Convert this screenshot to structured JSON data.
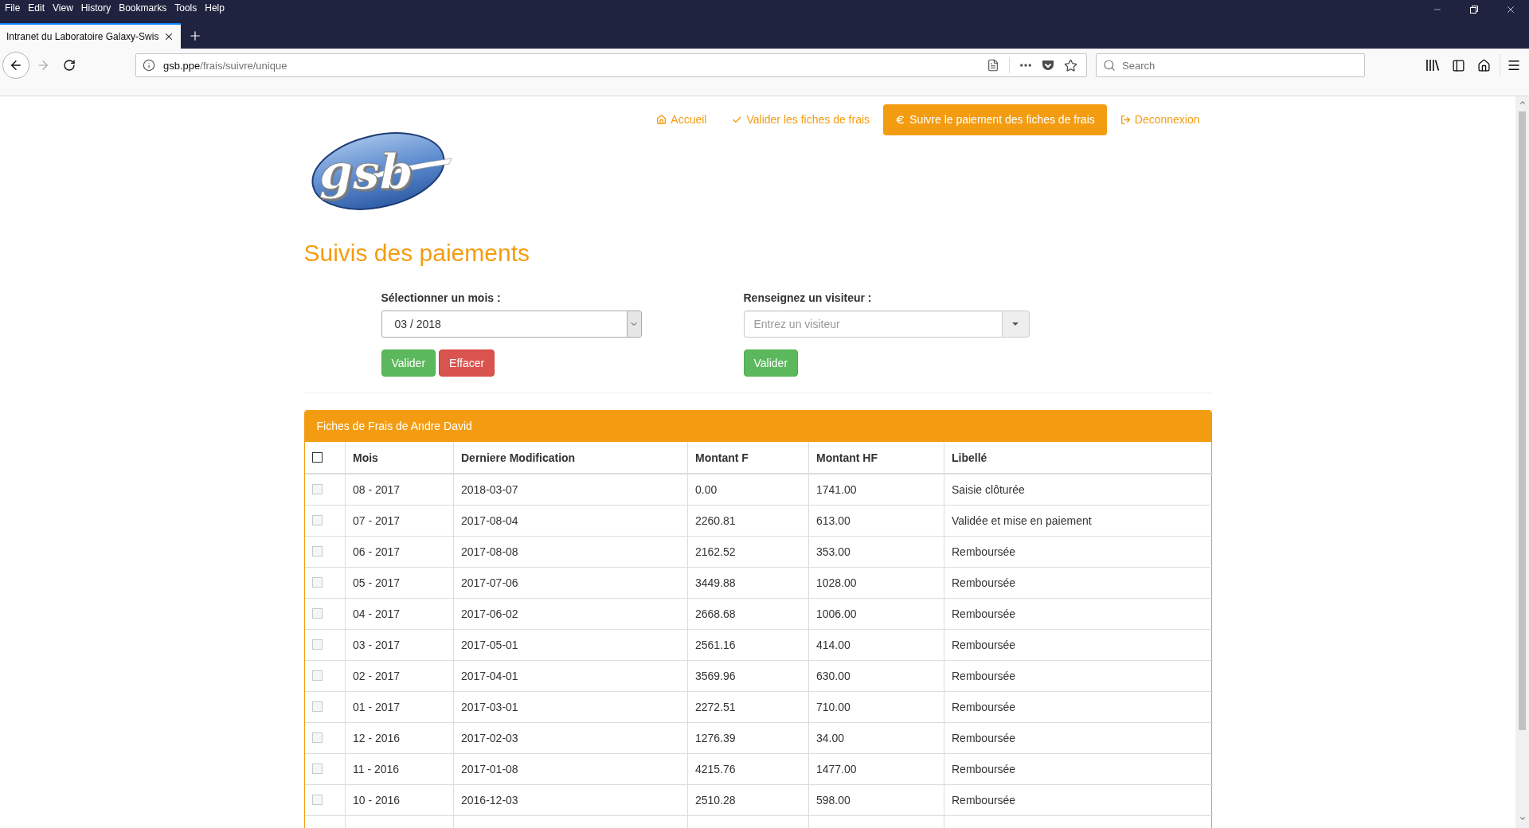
{
  "browser": {
    "menu": [
      "File",
      "Edit",
      "View",
      "History",
      "Bookmarks",
      "Tools",
      "Help"
    ],
    "tabs": [
      {
        "title": "Intranet du Laboratoire Galaxy-Swis",
        "selected": true
      }
    ],
    "url": {
      "host": "gsb.ppe",
      "path": "/frais/suivre/unique"
    },
    "search": {
      "placeholder": "Search"
    }
  },
  "page": {
    "logo": {
      "text": "gsb"
    },
    "nav": [
      {
        "label": "Accueil",
        "selected": false
      },
      {
        "label": "Valider les fiches de frais",
        "selected": false
      },
      {
        "label": "Suivre le paiement des fiches de frais",
        "selected": true
      },
      {
        "label": "Deconnexion",
        "selected": false
      }
    ],
    "title": "Suivis des paiements",
    "month": {
      "label": "Sélectionner un mois :",
      "value": "03 / 2018",
      "buttons": [
        {
          "label": "Valider",
          "kind": "success"
        },
        {
          "label": "Effacer",
          "kind": "danger"
        }
      ]
    },
    "visitor": {
      "label": "Renseignez un visiteur :",
      "placeholder": "Entrez un visiteur",
      "buttons": [
        {
          "label": "Valider",
          "kind": "success"
        }
      ]
    },
    "panel": {
      "title": "Fiches de Frais de Andre David",
      "select_all": {
        "checked": false,
        "disabled": false
      },
      "columns": [
        "Mois",
        "Derniere Modification",
        "Montant F",
        "Montant HF",
        "Libellé"
      ],
      "rows": [
        {
          "checked": false,
          "disabled": true,
          "cells": [
            "08 - 2017",
            "2018-03-07",
            "0.00",
            "1741.00",
            "Saisie clôturée"
          ]
        },
        {
          "checked": false,
          "disabled": true,
          "cells": [
            "07 - 2017",
            "2017-08-04",
            "2260.81",
            "613.00",
            "Validée et mise en paiement"
          ]
        },
        {
          "checked": false,
          "disabled": true,
          "cells": [
            "06 - 2017",
            "2017-08-08",
            "2162.52",
            "353.00",
            "Remboursée"
          ]
        },
        {
          "checked": false,
          "disabled": true,
          "cells": [
            "05 - 2017",
            "2017-07-06",
            "3449.88",
            "1028.00",
            "Remboursée"
          ]
        },
        {
          "checked": false,
          "disabled": true,
          "cells": [
            "04 - 2017",
            "2017-06-02",
            "2668.68",
            "1006.00",
            "Remboursée"
          ]
        },
        {
          "checked": false,
          "disabled": true,
          "cells": [
            "03 - 2017",
            "2017-05-01",
            "2561.16",
            "414.00",
            "Remboursée"
          ]
        },
        {
          "checked": false,
          "disabled": true,
          "cells": [
            "02 - 2017",
            "2017-04-01",
            "3569.96",
            "630.00",
            "Remboursée"
          ]
        },
        {
          "checked": false,
          "disabled": true,
          "cells": [
            "01 - 2017",
            "2017-03-01",
            "2272.51",
            "710.00",
            "Remboursée"
          ]
        },
        {
          "checked": false,
          "disabled": true,
          "cells": [
            "12 - 2016",
            "2017-02-03",
            "1276.39",
            "34.00",
            "Remboursée"
          ]
        },
        {
          "checked": false,
          "disabled": true,
          "cells": [
            "11 - 2016",
            "2017-01-08",
            "4215.76",
            "1477.00",
            "Remboursée"
          ]
        },
        {
          "checked": false,
          "disabled": true,
          "cells": [
            "10 - 2016",
            "2016-12-03",
            "2510.28",
            "598.00",
            "Remboursée"
          ]
        }
      ]
    }
  }
}
